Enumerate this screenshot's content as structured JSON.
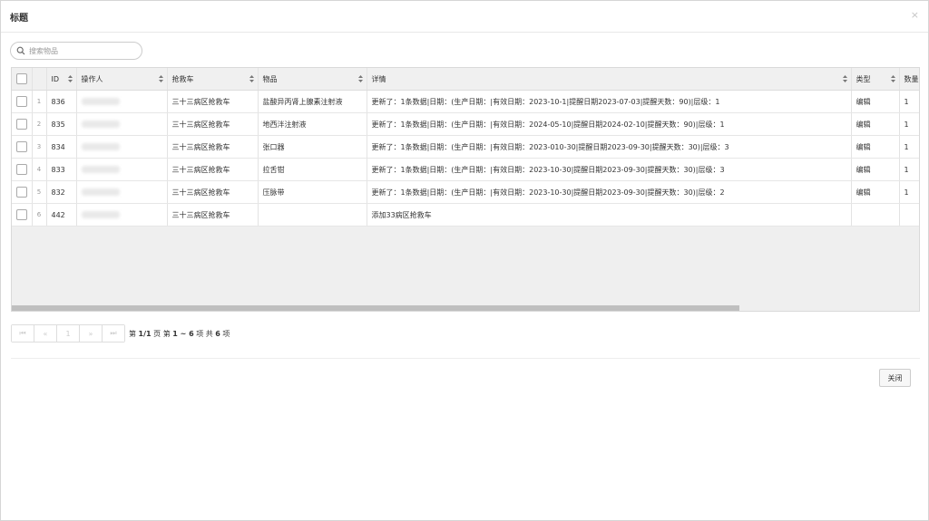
{
  "dialog": {
    "title": "标题",
    "close_icon": "×"
  },
  "search": {
    "placeholder": "搜索物品"
  },
  "table": {
    "columns": {
      "id": "ID",
      "operator": "操作人",
      "cart": "抢救车",
      "item": "物品",
      "detail": "详情",
      "type": "类型",
      "qty": "数量"
    },
    "rows": [
      {
        "n": "1",
        "id": "836",
        "cart": "三十三病区抢救车",
        "item": "盐酸异丙肾上腺素注射液",
        "detail": "更新了：1条数据|日期：(生产日期：|有效日期：2023-10-1|提醒日期2023-07-03|提醒天数：90)|层级：1",
        "type": "编辑",
        "qty": "1"
      },
      {
        "n": "2",
        "id": "835",
        "cart": "三十三病区抢救车",
        "item": "地西泮注射液",
        "detail": "更新了：1条数据|日期：(生产日期：|有效日期：2024-05-10|提醒日期2024-02-10|提醒天数：90)|层级：1",
        "type": "编辑",
        "qty": "1"
      },
      {
        "n": "3",
        "id": "834",
        "cart": "三十三病区抢救车",
        "item": "张口器",
        "detail": "更新了：1条数据|日期：(生产日期：|有效日期：2023-010-30|提醒日期2023-09-30|提醒天数：30)|层级：3",
        "type": "编辑",
        "qty": "1"
      },
      {
        "n": "4",
        "id": "833",
        "cart": "三十三病区抢救车",
        "item": "拉舌钳",
        "detail": "更新了：1条数据|日期：(生产日期：|有效日期：2023-10-30|提醒日期2023-09-30|提醒天数：30)|层级：3",
        "type": "编辑",
        "qty": "1"
      },
      {
        "n": "5",
        "id": "832",
        "cart": "三十三病区抢救车",
        "item": "压脉带",
        "detail": "更新了：1条数据|日期：(生产日期：|有效日期：2023-10-30|提醒日期2023-09-30|提醒天数：30)|层级：2",
        "type": "编辑",
        "qty": "1"
      },
      {
        "n": "6",
        "id": "442",
        "cart": "三十三病区抢救车",
        "item": "",
        "detail": "添加33病区抢救车",
        "type": "",
        "qty": ""
      }
    ]
  },
  "pager": {
    "first": "⏮",
    "prev": "«",
    "page": "1",
    "next": "»",
    "last": "⏭",
    "t1": "第 ",
    "page_value": "1/1",
    "t2": " 页  第 ",
    "range": "1 ~ 6",
    "t3": " 项  共 ",
    "total": "6",
    "t4": " 项"
  },
  "footer": {
    "close_label": "关闭"
  }
}
